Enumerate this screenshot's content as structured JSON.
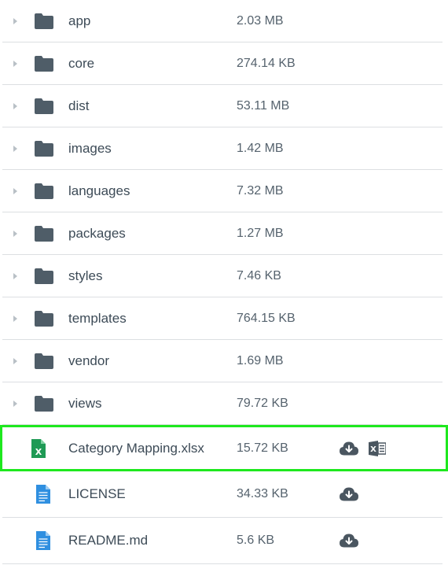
{
  "entries": [
    {
      "name": "app",
      "size": "2.03 MB",
      "type": "folder"
    },
    {
      "name": "core",
      "size": "274.14 KB",
      "type": "folder"
    },
    {
      "name": "dist",
      "size": "53.11 MB",
      "type": "folder"
    },
    {
      "name": "images",
      "size": "1.42 MB",
      "type": "folder"
    },
    {
      "name": "languages",
      "size": "7.32 MB",
      "type": "folder"
    },
    {
      "name": "packages",
      "size": "1.27 MB",
      "type": "folder"
    },
    {
      "name": "styles",
      "size": "7.46 KB",
      "type": "folder"
    },
    {
      "name": "templates",
      "size": "764.15 KB",
      "type": "folder"
    },
    {
      "name": "vendor",
      "size": "1.69 MB",
      "type": "folder"
    },
    {
      "name": "views",
      "size": "79.72 KB",
      "type": "folder"
    },
    {
      "name": "Category Mapping.xlsx",
      "size": "15.72 KB",
      "type": "excel-file",
      "selected": true
    },
    {
      "name": "LICENSE",
      "size": "34.33 KB",
      "type": "document-file"
    },
    {
      "name": "README.md",
      "size": "5.6 KB",
      "type": "document-file"
    }
  ],
  "icons": {
    "folder": "folder-icon",
    "excel_file": "excel-file-icon",
    "document_file": "document-file-icon",
    "download": "cloud-download-icon",
    "open_in_excel": "excel-open-icon",
    "expand": "caret-right-icon"
  },
  "colors": {
    "folder": "#4f5d68",
    "excel": "#1f9a55",
    "document": "#2f8fe0",
    "selection_outline": "#1ee81e",
    "divider": "#dcdfe2",
    "action_icon": "#4a5660"
  }
}
